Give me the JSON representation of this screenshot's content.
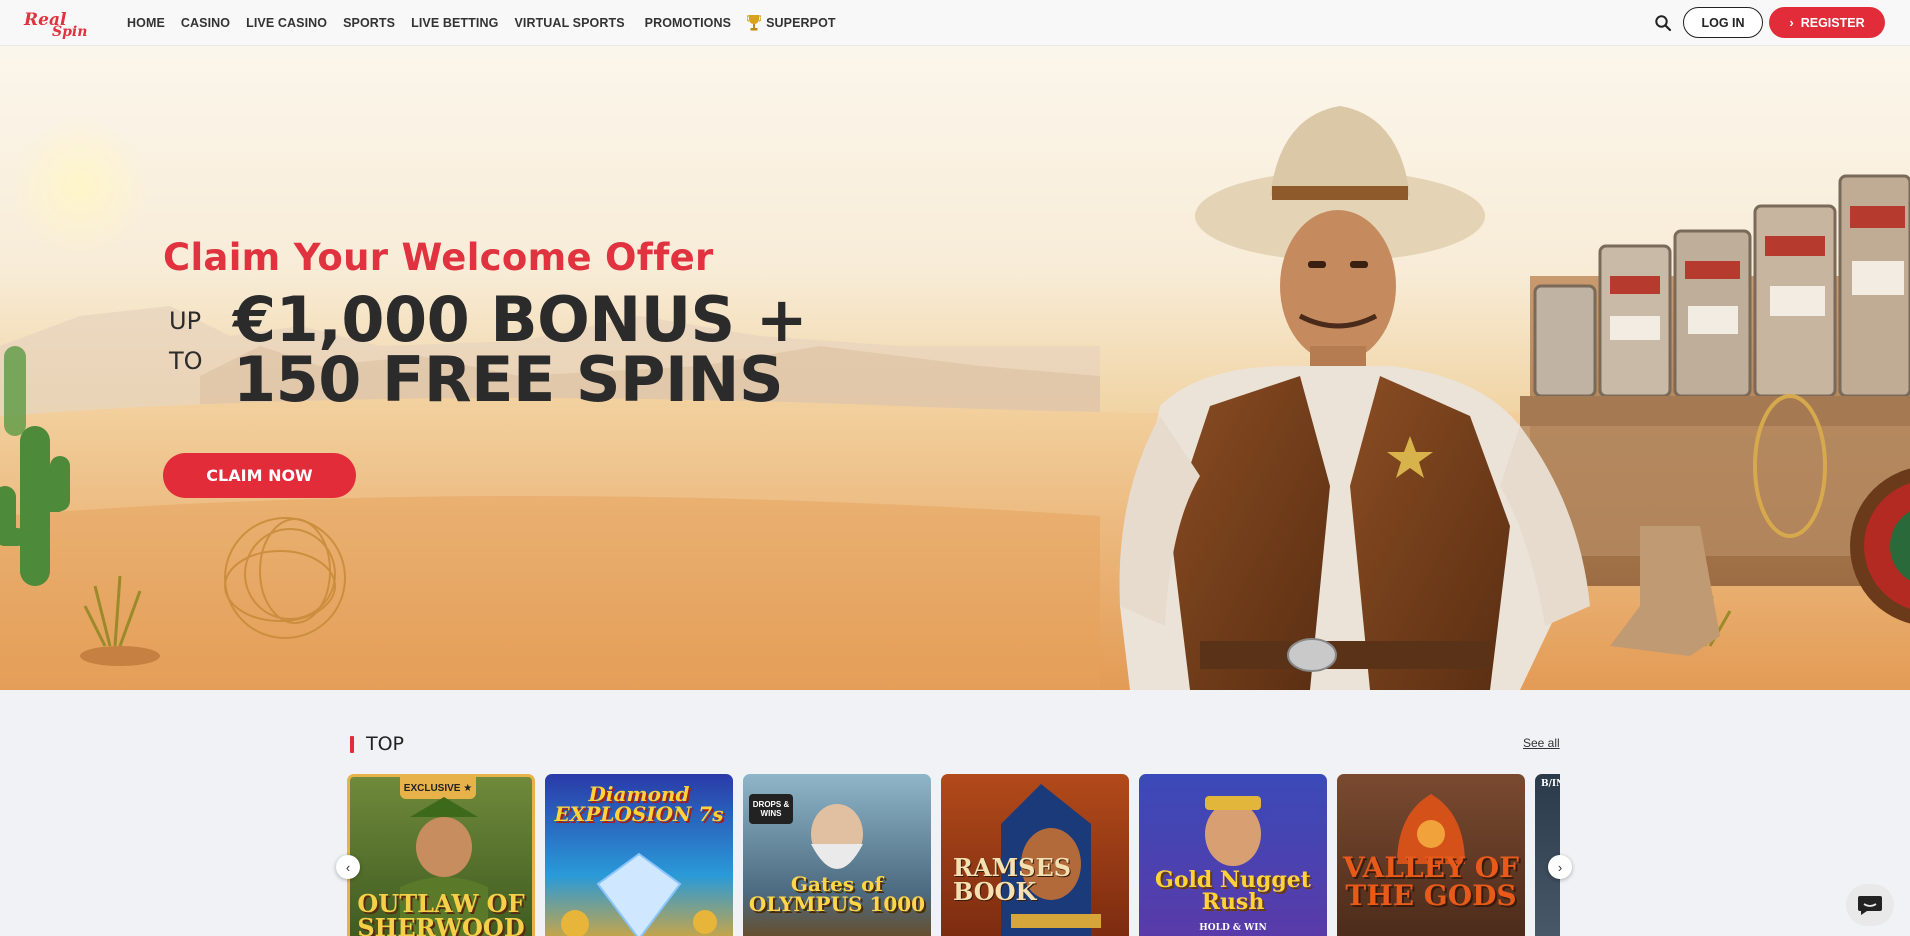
{
  "brand": {
    "logo_text_1": "Real",
    "logo_text_2": "Spin",
    "accent": "#e22c3a"
  },
  "nav": {
    "items": [
      {
        "label": "HOME"
      },
      {
        "label": "CASINO"
      },
      {
        "label": "LIVE CASINO"
      },
      {
        "label": "SPORTS"
      },
      {
        "label": "LIVE BETTING"
      },
      {
        "label": "VIRTUAL SPORTS"
      },
      {
        "label": "PROMOTIONS"
      },
      {
        "label": "SUPERPOT",
        "icon": "trophy-icon"
      }
    ],
    "search_icon": "search-icon",
    "login_label": "LOG IN",
    "register_label": "REGISTER"
  },
  "hero": {
    "title": "Claim Your Welcome Offer",
    "up": "UP",
    "to": "TO",
    "line1": "€1,000 BONUS +",
    "line2": "150 FREE SPINS",
    "cta": "CLAIM NOW"
  },
  "top": {
    "title": "TOP",
    "see_all": "See all",
    "games": [
      {
        "name": "OUTLAW OF SHERWOOD",
        "badge": "EXCLUSIVE ★"
      },
      {
        "name": "Diamond EXPLOSION 7s"
      },
      {
        "name": "Gates of OLYMPUS 1000",
        "badge": "DROPS & WINS"
      },
      {
        "name": "RAMSES BOOK"
      },
      {
        "name": "Gold Nugget Rush",
        "sub": "HOLD & WIN"
      },
      {
        "name": "VALLEY OF THE GODS"
      },
      {
        "name": "B/ING"
      }
    ]
  }
}
